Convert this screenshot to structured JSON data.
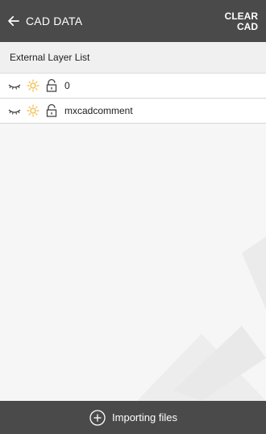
{
  "header": {
    "title": "CAD DATA",
    "clear_line1": "CLEAR",
    "clear_line2": "CAD",
    "background": "#4a4a4a"
  },
  "section": {
    "title": "External Layer List"
  },
  "layers": [
    {
      "name": "0",
      "visibility_icon": "eye-closed-icon",
      "state_icon": "sun-icon",
      "lock_icon": "unlock-icon"
    },
    {
      "name": "mxcadcomment",
      "visibility_icon": "eye-closed-icon",
      "state_icon": "sun-icon",
      "lock_icon": "unlock-icon"
    }
  ],
  "footer": {
    "import_label": "Importing files",
    "icon": "plus-circle-icon"
  },
  "colors": {
    "sun": "#f5b942",
    "bar": "#4a4a4a",
    "text": "#202020"
  }
}
